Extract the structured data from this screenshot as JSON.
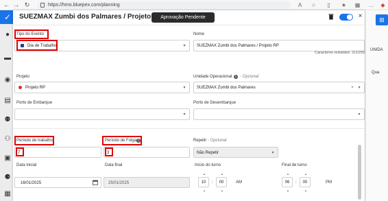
{
  "browser": {
    "url": "https://hmo.bluepex.com/planning"
  },
  "modal": {
    "title": "SUEZMAX Zumbi dos Palmares / Projeto RP",
    "status": "Aprovação Pendente",
    "fields": {
      "event_type": {
        "label": "Tipo do Evento",
        "value": "Dia de Trabalho"
      },
      "name": {
        "label": "Nome",
        "value": "SUEZMAX Zumbi dos Palmares / Projeto RP",
        "remaining": "Caracteres restantes: 211/250"
      },
      "project": {
        "label": "Projeto",
        "value": "Projeto RP"
      },
      "operational_unit": {
        "label": "Unidade Operacional",
        "optional": "- Opcional",
        "value": "SUEZMAX Zumbi dos Palmares"
      },
      "embark_port": {
        "label": "Porto de Embarque",
        "value": ""
      },
      "disembark_port": {
        "label": "Porto de Desembarque",
        "value": ""
      },
      "work_period": {
        "label": "Período de trabalho",
        "value": "7"
      },
      "rest_period": {
        "label": "Período de Folga",
        "value": "3"
      },
      "repeat": {
        "label": "Repetir",
        "optional": "- Opcional",
        "value": "Não Repetir"
      },
      "start_date": {
        "label": "Data inicial",
        "value": "16/01/2025"
      },
      "end_date": {
        "label": "Data final",
        "value": "25/01/2025"
      },
      "shift_start": {
        "label": "Início do turno",
        "hour": "10",
        "minute": "00",
        "ampm": "AM"
      },
      "shift_end": {
        "label": "Final de turno",
        "hour": "06",
        "minute": "00",
        "ampm": "PM"
      }
    }
  },
  "background": {
    "col_header": "UNIDA",
    "row_text": "Qua"
  },
  "colors": {
    "accent": "#1a73e8",
    "highlight": "#e00000",
    "badge": "#2b2b2b"
  }
}
